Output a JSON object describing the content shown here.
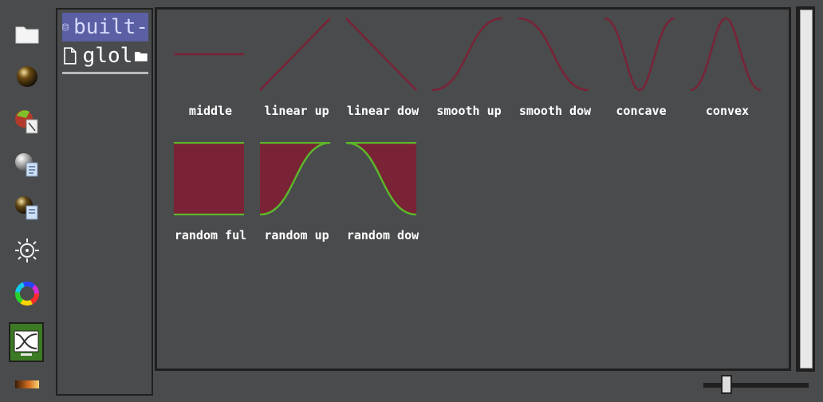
{
  "toolbar": {
    "tools": [
      {
        "icon": "folder-icon"
      },
      {
        "icon": "material-sphere-icon"
      },
      {
        "icon": "texture-map-icon"
      },
      {
        "icon": "material-doc-icon"
      },
      {
        "icon": "material-file-icon"
      },
      {
        "icon": "light-icon"
      },
      {
        "icon": "color-wheel-icon"
      },
      {
        "icon": "curve-preset-icon",
        "active": true
      },
      {
        "icon": "gradient-icon"
      }
    ]
  },
  "library": {
    "items": [
      {
        "label": "built-",
        "icon": "database-icon",
        "selected": true
      },
      {
        "label": "glol",
        "icon": "file-icon",
        "suffix_icon": "folder-icon"
      }
    ]
  },
  "presets": [
    {
      "label": "middle",
      "shape": "middle"
    },
    {
      "label": "linear up",
      "shape": "linear-up"
    },
    {
      "label": "linear dow",
      "shape": "linear-down"
    },
    {
      "label": "smooth up",
      "shape": "smooth-up"
    },
    {
      "label": "smooth dow",
      "shape": "smooth-down"
    },
    {
      "label": "concave",
      "shape": "concave"
    },
    {
      "label": "convex",
      "shape": "convex"
    },
    {
      "label": "random ful",
      "shape": "random-full"
    },
    {
      "label": "random up",
      "shape": "random-up"
    },
    {
      "label": "random dow",
      "shape": "random-down"
    }
  ],
  "colors": {
    "curve": "#7a2236",
    "fill": "#7a2236",
    "edge": "#5cb82a",
    "accent": "#5b5fa3"
  }
}
